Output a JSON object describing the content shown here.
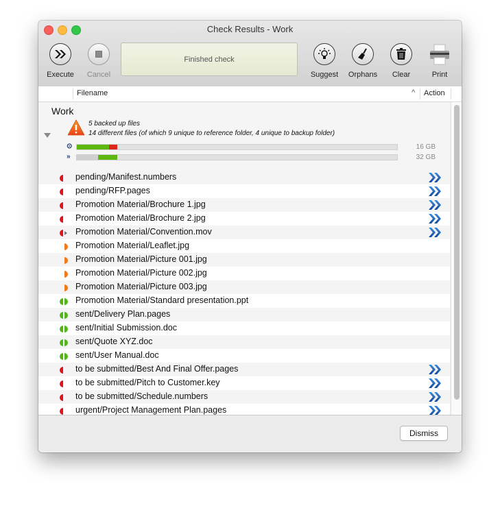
{
  "window": {
    "title": "Check Results - Work"
  },
  "toolbar": {
    "execute": {
      "label": "Execute",
      "icon": "fast-forward-icon",
      "enabled": true
    },
    "cancel": {
      "label": "Cancel",
      "icon": "stop-icon",
      "enabled": false
    },
    "status": "Finished check",
    "suggest": {
      "label": "Suggest",
      "icon": "lightbulb-icon"
    },
    "orphans": {
      "label": "Orphans",
      "icon": "broom-icon"
    },
    "clear": {
      "label": "Clear",
      "icon": "trash-icon"
    },
    "print": {
      "label": "Print",
      "icon": "printer-icon"
    }
  },
  "table": {
    "columns": {
      "filename": "Filename",
      "action": "Action",
      "sort": "^"
    },
    "group": {
      "title": "Work",
      "line1": "5 backed up files",
      "line2": "14 different files (of which 9 unique to reference folder, 4 unique to backup folder)",
      "bars": [
        {
          "icon": "reference-icon",
          "glyph": "⊙",
          "size": "16 GB",
          "segments": [
            {
              "start": 0.0,
              "end": 0.1,
              "color": "#5cb80f"
            },
            {
              "start": 0.1,
              "end": 0.126,
              "color": "#e0261a"
            }
          ]
        },
        {
          "icon": "backup-icon",
          "glyph": "»",
          "size": "32 GB",
          "segments": [
            {
              "start": 0.0,
              "end": 0.066,
              "color": "#d0d0d0"
            },
            {
              "start": 0.066,
              "end": 0.126,
              "color": "#5cb80f"
            }
          ]
        }
      ]
    },
    "rows": [
      {
        "name": "pending/Manifest.numbers",
        "status": "red-left",
        "action": true
      },
      {
        "name": "pending/RFP.pages",
        "status": "red-left",
        "action": true
      },
      {
        "name": "Promotion Material/Brochure 1.jpg",
        "status": "red-left",
        "action": true
      },
      {
        "name": "Promotion Material/Brochure 2.jpg",
        "status": "red-left",
        "action": true
      },
      {
        "name": "Promotion Material/Convention.mov",
        "status": "red-left-gray-right",
        "action": true
      },
      {
        "name": "Promotion Material/Leaflet.jpg",
        "status": "orange-right",
        "action": false
      },
      {
        "name": "Promotion Material/Picture 001.jpg",
        "status": "orange-right",
        "action": false
      },
      {
        "name": "Promotion Material/Picture 002.jpg",
        "status": "orange-right",
        "action": false
      },
      {
        "name": "Promotion Material/Picture 003.jpg",
        "status": "orange-right",
        "action": false
      },
      {
        "name": "Promotion Material/Standard presentation.ppt",
        "status": "green-both",
        "action": false
      },
      {
        "name": "sent/Delivery Plan.pages",
        "status": "green-both",
        "action": false
      },
      {
        "name": "sent/Initial Submission.doc",
        "status": "green-both",
        "action": false
      },
      {
        "name": "sent/Quote XYZ.doc",
        "status": "green-both",
        "action": false
      },
      {
        "name": "sent/User Manual.doc",
        "status": "green-both",
        "action": false
      },
      {
        "name": "to be submitted/Best And Final Offer.pages",
        "status": "red-left",
        "action": true
      },
      {
        "name": "to be submitted/Pitch to Customer.key",
        "status": "red-left",
        "action": true
      },
      {
        "name": "to be submitted/Schedule.numbers",
        "status": "red-left",
        "action": true
      },
      {
        "name": "urgent/Project Management Plan.pages",
        "status": "red-left",
        "action": true
      }
    ]
  },
  "colors": {
    "red": "#e0131e",
    "orange": "#f07a1a",
    "green": "#52b51a",
    "gray": "#777777",
    "action_blue": "#1b5fb5"
  },
  "footer": {
    "dismiss_label": "Dismiss"
  }
}
